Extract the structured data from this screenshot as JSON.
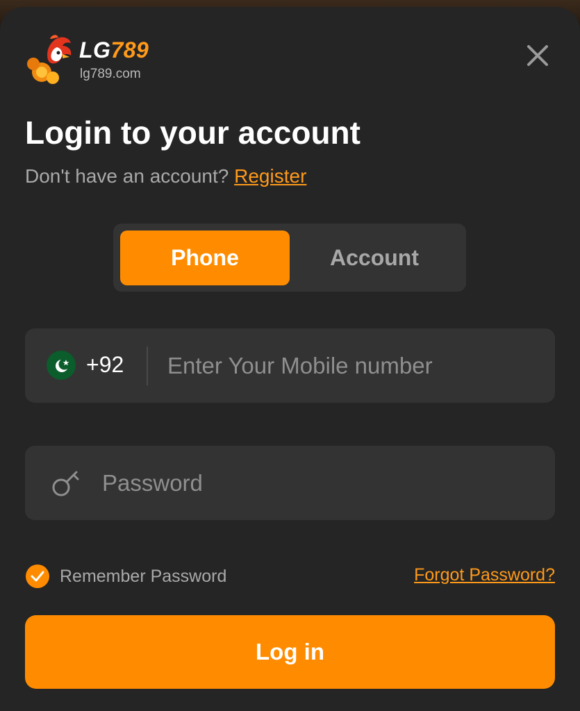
{
  "brand": {
    "name_part1": "LG",
    "name_part2": "789",
    "domain": "lg789.com",
    "logo_icon": "rooster-chips-logo"
  },
  "header": {
    "title": "Login to your account",
    "no_account_text": "Don't have an account?",
    "register_link": "Register",
    "close_icon": "close-icon"
  },
  "tabs": [
    {
      "label": "Phone",
      "active": true
    },
    {
      "label": "Account",
      "active": false
    }
  ],
  "phone_field": {
    "country_flag": "pakistan-flag-icon",
    "country_code": "+92",
    "value": "",
    "placeholder": "Enter Your Mobile number"
  },
  "password_field": {
    "icon": "key-icon",
    "value": "",
    "placeholder": "Password"
  },
  "options": {
    "remember_label": "Remember Password",
    "remember_checked": true,
    "forgot_link": "Forgot Password?"
  },
  "submit": {
    "label": "Log in"
  },
  "colors": {
    "accent": "#ff8c00",
    "modal_bg": "#252525",
    "field_bg": "#333333"
  }
}
